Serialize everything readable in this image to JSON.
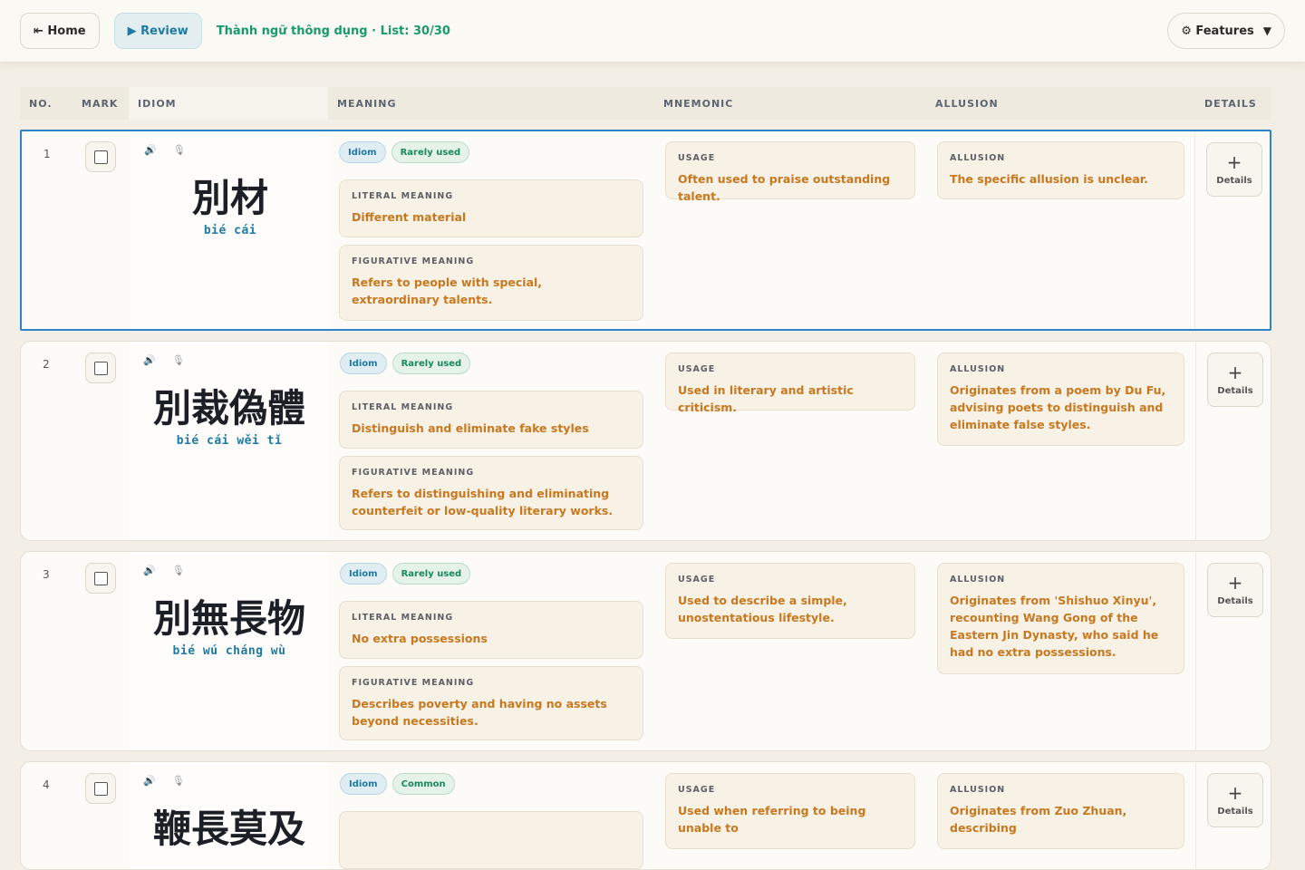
{
  "topbar": {
    "home_label": "⇤ Home",
    "review_label": "▶ Review",
    "list_info": "Thành ngữ thông dụng · List: 30/30",
    "features_label": "⚙ Features",
    "features_caret": "▼"
  },
  "columns": [
    "NO.",
    "MARK",
    "IDIOM",
    "MEANING",
    "MNEMONIC",
    "ALLUSION",
    "DETAILS"
  ],
  "labels": {
    "literal": "LITERAL MEANING",
    "figurative": "FIGURATIVE MEANING",
    "usage": "USAGE",
    "allusion": "ALLUSION",
    "details": "Details",
    "plus": "+",
    "speaker_icon": "🔊",
    "mic_icon": "🎙"
  },
  "rows": [
    {
      "no": "1",
      "hanzi": "別材",
      "pinyin": "bié cái",
      "type": "Idiom",
      "frequency": "Rarely used",
      "literal": "Different material",
      "figurative": "Refers to people with special, extraordinary talents.",
      "usage": "Often used to praise outstanding talent.",
      "allusion": "The specific allusion is unclear."
    },
    {
      "no": "2",
      "hanzi": "別裁偽體",
      "pinyin": "bié cái wěi tǐ",
      "type": "Idiom",
      "frequency": "Rarely used",
      "literal": "Distinguish and eliminate fake styles",
      "figurative": "Refers to distinguishing and eliminating counterfeit or low-quality literary works.",
      "usage": "Used in literary and artistic criticism.",
      "allusion": "Originates from a poem by Du Fu, advising poets to distinguish and eliminate false styles."
    },
    {
      "no": "3",
      "hanzi": "別無長物",
      "pinyin": "bié wú cháng wù",
      "type": "Idiom",
      "frequency": "Rarely used",
      "literal": "No extra possessions",
      "figurative": "Describes poverty and having no assets beyond necessities.",
      "usage": "Used to describe a simple, unostentatious lifestyle.",
      "allusion": "Originates from 'Shishuo Xinyu', recounting Wang Gong of the Eastern Jin Dynasty, who said he had no extra possessions."
    },
    {
      "no": "4",
      "hanzi": "鞭長莫及",
      "pinyin": "biān cháng mò jí",
      "type": "Idiom",
      "frequency": "Common",
      "literal": "",
      "figurative": "",
      "usage": "Used when referring to being unable to",
      "allusion": "Originates from Zuo Zhuan, describing"
    }
  ]
}
